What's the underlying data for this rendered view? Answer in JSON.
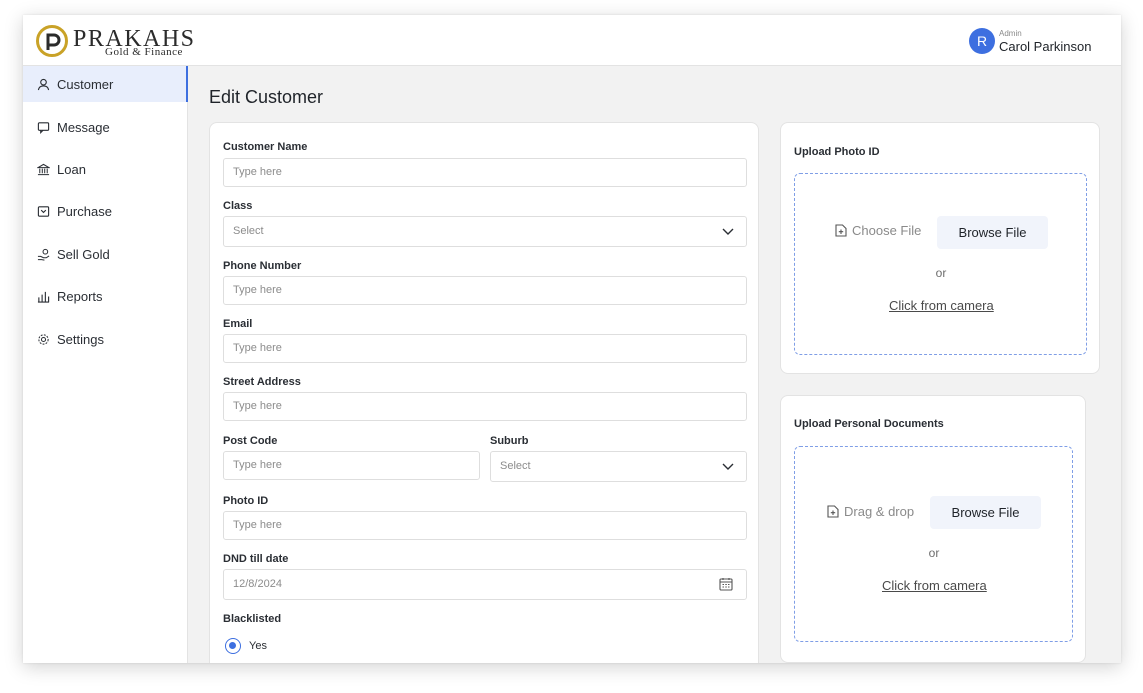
{
  "brand": {
    "name": "PRAKAHS",
    "tagline": "Gold & Finance",
    "logo_icon": "brand-logo-icon",
    "accent": "#c9a227"
  },
  "user": {
    "avatar_initial": "R",
    "role": "Admin",
    "name": "Carol Parkinson",
    "avatar_color": "#3d6fe0"
  },
  "sidebar": {
    "items": [
      {
        "label": "Customer",
        "icon": "user-icon",
        "active": true
      },
      {
        "label": "Message",
        "icon": "message-icon"
      },
      {
        "label": "Loan",
        "icon": "bank-icon"
      },
      {
        "label": "Purchase",
        "icon": "purchase-icon"
      },
      {
        "label": "Sell Gold",
        "icon": "hand-coin-icon"
      },
      {
        "label": "Reports",
        "icon": "bar-chart-icon"
      },
      {
        "label": "Settings",
        "icon": "gear-icon"
      }
    ]
  },
  "page": {
    "title": "Edit Customer"
  },
  "form": {
    "customer_name": {
      "label": "Customer Name",
      "placeholder": "Type here"
    },
    "class": {
      "label": "Class",
      "placeholder": "Select"
    },
    "phone": {
      "label": "Phone Number",
      "placeholder": "Type here"
    },
    "email": {
      "label": "Email",
      "placeholder": "Type here"
    },
    "street": {
      "label": "Street Address",
      "placeholder": "Type here"
    },
    "post_code": {
      "label": "Post Code",
      "placeholder": "Type here"
    },
    "suburb": {
      "label": "Suburb",
      "placeholder": "Select"
    },
    "photo_id": {
      "label": "Photo ID",
      "placeholder": "Type here"
    },
    "dnd_date": {
      "label": "DND till date",
      "value": "12/8/2024"
    },
    "blacklisted": {
      "label": "Blacklisted",
      "option_yes": "Yes",
      "selected": "Yes"
    }
  },
  "upload_photo": {
    "title": "Upload Photo ID",
    "choose_label": "Choose File",
    "browse_label": "Browse File",
    "or_label": "or",
    "camera_label": "Click from camera"
  },
  "upload_docs": {
    "title": "Upload Personal Documents",
    "choose_label": "Drag & drop",
    "browse_label": "Browse File",
    "or_label": "or",
    "camera_label": "Click from camera"
  }
}
